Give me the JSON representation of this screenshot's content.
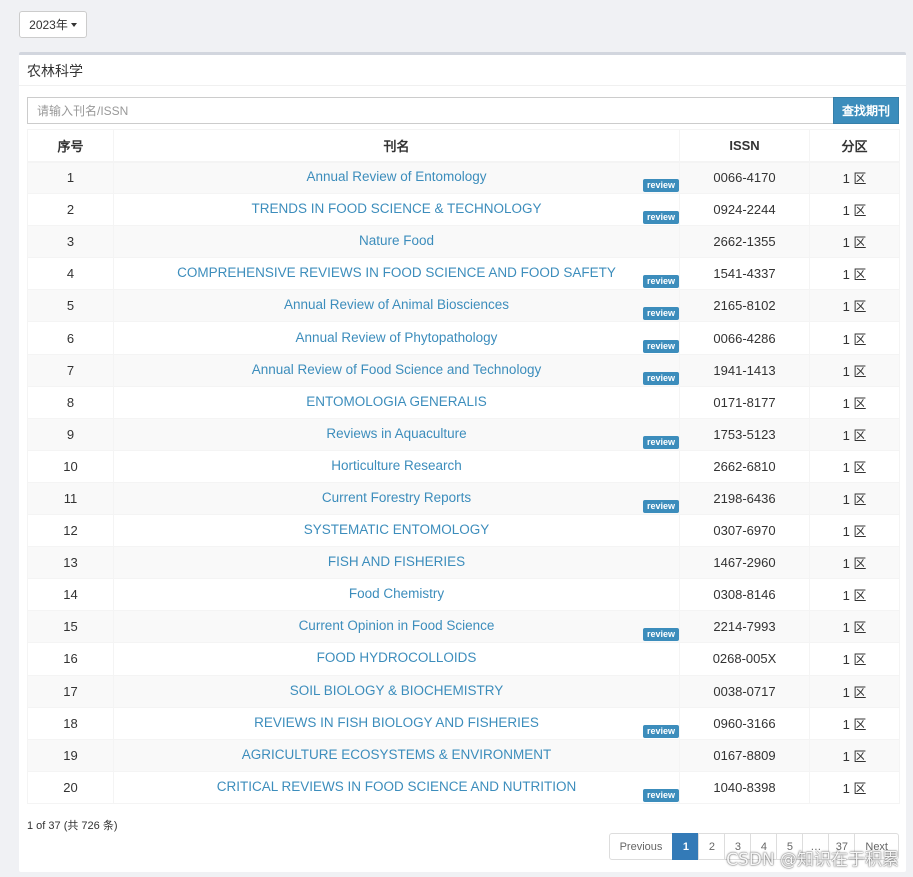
{
  "year_selector": {
    "label": "2023年"
  },
  "panel": {
    "title": "农林科学"
  },
  "search": {
    "placeholder": "请输入刊名/ISSN",
    "value": "",
    "button_label": "查找期刊"
  },
  "table": {
    "headers": {
      "index": "序号",
      "name": "刊名",
      "issn": "ISSN",
      "zone": "分区"
    },
    "rows": [
      {
        "index": "1",
        "name": "Annual Review of Entomology",
        "issn": "0066-4170",
        "zone": "1 区",
        "badge": "review"
      },
      {
        "index": "2",
        "name": "TRENDS IN FOOD SCIENCE & TECHNOLOGY",
        "issn": "0924-2244",
        "zone": "1 区",
        "badge": "review"
      },
      {
        "index": "3",
        "name": "Nature Food",
        "issn": "2662-1355",
        "zone": "1 区",
        "badge": ""
      },
      {
        "index": "4",
        "name": "COMPREHENSIVE REVIEWS IN FOOD SCIENCE AND FOOD SAFETY",
        "issn": "1541-4337",
        "zone": "1 区",
        "badge": "review"
      },
      {
        "index": "5",
        "name": "Annual Review of Animal Biosciences",
        "issn": "2165-8102",
        "zone": "1 区",
        "badge": "review"
      },
      {
        "index": "6",
        "name": "Annual Review of Phytopathology",
        "issn": "0066-4286",
        "zone": "1 区",
        "badge": "review"
      },
      {
        "index": "7",
        "name": "Annual Review of Food Science and Technology",
        "issn": "1941-1413",
        "zone": "1 区",
        "badge": "review"
      },
      {
        "index": "8",
        "name": "ENTOMOLOGIA GENERALIS",
        "issn": "0171-8177",
        "zone": "1 区",
        "badge": ""
      },
      {
        "index": "9",
        "name": "Reviews in Aquaculture",
        "issn": "1753-5123",
        "zone": "1 区",
        "badge": "review"
      },
      {
        "index": "10",
        "name": "Horticulture Research",
        "issn": "2662-6810",
        "zone": "1 区",
        "badge": ""
      },
      {
        "index": "11",
        "name": "Current Forestry Reports",
        "issn": "2198-6436",
        "zone": "1 区",
        "badge": "review"
      },
      {
        "index": "12",
        "name": "SYSTEMATIC ENTOMOLOGY",
        "issn": "0307-6970",
        "zone": "1 区",
        "badge": ""
      },
      {
        "index": "13",
        "name": "FISH AND FISHERIES",
        "issn": "1467-2960",
        "zone": "1 区",
        "badge": ""
      },
      {
        "index": "14",
        "name": "Food Chemistry",
        "issn": "0308-8146",
        "zone": "1 区",
        "badge": ""
      },
      {
        "index": "15",
        "name": "Current Opinion in Food Science",
        "issn": "2214-7993",
        "zone": "1 区",
        "badge": "review"
      },
      {
        "index": "16",
        "name": "FOOD HYDROCOLLOIDS",
        "issn": "0268-005X",
        "zone": "1 区",
        "badge": ""
      },
      {
        "index": "17",
        "name": "SOIL BIOLOGY & BIOCHEMISTRY",
        "issn": "0038-0717",
        "zone": "1 区",
        "badge": ""
      },
      {
        "index": "18",
        "name": "REVIEWS IN FISH BIOLOGY AND FISHERIES",
        "issn": "0960-3166",
        "zone": "1 区",
        "badge": "review"
      },
      {
        "index": "19",
        "name": "AGRICULTURE ECOSYSTEMS & ENVIRONMENT",
        "issn": "0167-8809",
        "zone": "1 区",
        "badge": ""
      },
      {
        "index": "20",
        "name": "CRITICAL REVIEWS IN FOOD SCIENCE AND NUTRITION",
        "issn": "1040-8398",
        "zone": "1 区",
        "badge": "review"
      }
    ]
  },
  "summary": "1 of 37 (共 726 条)",
  "pagination": {
    "previous": "Previous",
    "pages": [
      "1",
      "2",
      "3",
      "4",
      "5",
      "…",
      "37"
    ],
    "active": "1",
    "next": "Next"
  },
  "watermark": "CSDN @知识在于积累",
  "colors": {
    "accent": "#3c8dbc",
    "active_page": "#337ab7",
    "background": "#f0f1f4"
  }
}
